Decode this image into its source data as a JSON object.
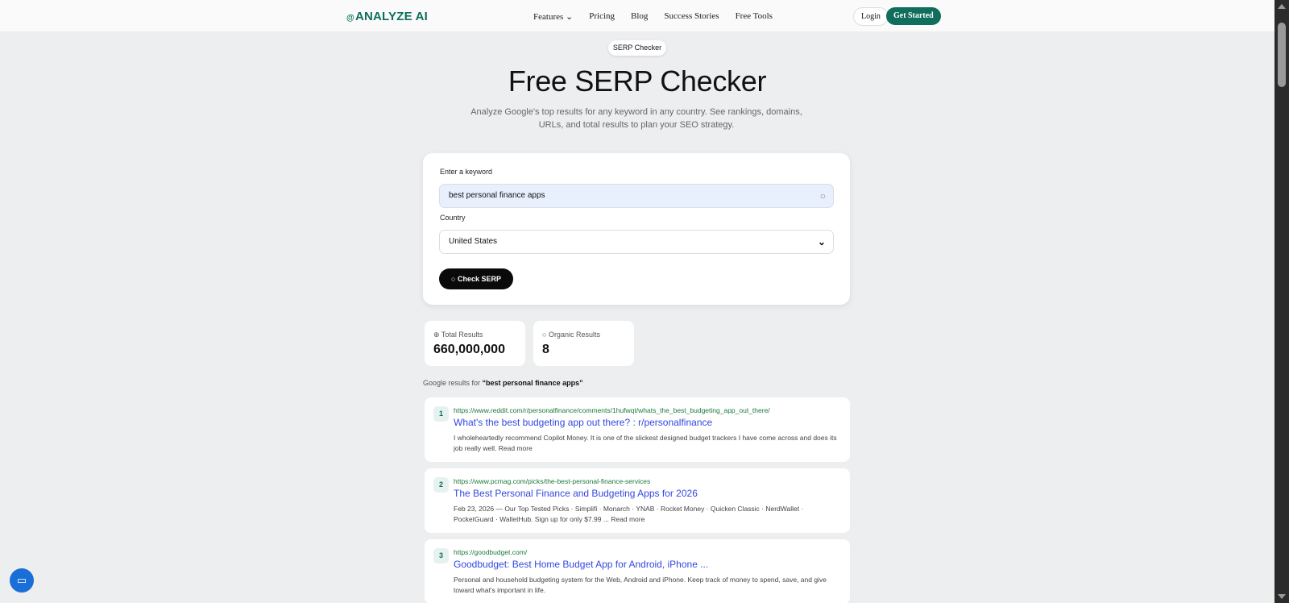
{
  "nav": {
    "logo": "ANALYZE AI",
    "logo_mark": "@",
    "links": [
      "Features ⌄",
      "Pricing",
      "Blog",
      "Success Stories",
      "Free Tools"
    ],
    "login": "Login",
    "get_started": "Get Started"
  },
  "hero": {
    "badge": "SERP Checker",
    "title": "Free SERP Checker",
    "subtitle": "Analyze Google's top results for any keyword in any country. See rankings, domains, URLs, and total results to plan your SEO strategy."
  },
  "form": {
    "keyword_label": "Enter a keyword",
    "keyword_value": "best personal finance apps",
    "country_label": "Country",
    "country_value": "United States",
    "submit": "Check SERP"
  },
  "stats": [
    {
      "label": "Total Results",
      "value": "660,000,000",
      "icon": "globe-icon"
    },
    {
      "label": "Organic Results",
      "value": "8",
      "icon": "search-icon"
    }
  ],
  "results_heading": {
    "prefix": "Google results for ",
    "query": "“best personal finance apps”"
  },
  "results": [
    {
      "rank": "1",
      "url": "https://www.reddit.com/r/personalfinance/comments/1hufwqt/whats_the_best_budgeting_app_out_there/",
      "title": "What's the best budgeting app out there? : r/personalfinance",
      "snippet": "I wholeheartedly recommend Copilot Money. It is one of the slickest designed budget trackers I have come across and does its job really well. Read more"
    },
    {
      "rank": "2",
      "url": "https://www.pcmag.com/picks/the-best-personal-finance-services",
      "title": "The Best Personal Finance and Budgeting Apps for 2026",
      "snippet": "Feb 23, 2026 — Our Top Tested Picks · Simplifi · Monarch · YNAB · Rocket Money · Quicken Classic · NerdWallet · PocketGuard · WalletHub. Sign up for only $7.99 ... Read more"
    },
    {
      "rank": "3",
      "url": "https://goodbudget.com/",
      "title": "Goodbudget: Best Home Budget App for Android, iPhone ...",
      "snippet": "Personal and household budgeting system for the Web, Android and iPhone. Keep track of money to spend, save, and give toward what's important in life."
    }
  ]
}
